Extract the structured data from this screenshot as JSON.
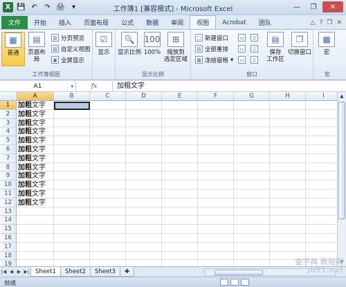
{
  "window": {
    "title": "工作簿1  [兼容模式] - Microsoft Excel",
    "app_icon": "X"
  },
  "tabs": [
    {
      "label": "文件"
    },
    {
      "label": "开始"
    },
    {
      "label": "插入"
    },
    {
      "label": "页面布局"
    },
    {
      "label": "公式"
    },
    {
      "label": "数据"
    },
    {
      "label": "审阅"
    },
    {
      "label": "视图"
    },
    {
      "label": "Acrobat"
    },
    {
      "label": "团队"
    }
  ],
  "ribbon": {
    "workbook_views": {
      "label": "工作簿视图",
      "normal": "普通",
      "page_layout": "页面布局",
      "page_break": "分页预览",
      "custom": "自定义视图",
      "fullscreen": "全屏显示"
    },
    "show": {
      "label": "显示"
    },
    "zoom": {
      "label": "显示比例",
      "zoom": "显示比例",
      "zoom100": "100%",
      "zoom_selection_1": "缩放到",
      "zoom_selection_2": "选定区域"
    },
    "window": {
      "label": "窗口",
      "new_window": "新建窗口",
      "arrange_all": "全部重排",
      "freeze": "冻结窗格",
      "save_workspace_1": "保存",
      "save_workspace_2": "工作区",
      "switch_windows": "切换窗口"
    },
    "macros": {
      "label": "宏",
      "macros": "宏"
    }
  },
  "formula_bar": {
    "name_box": "A1",
    "fx": "fx",
    "content": "加粗文字"
  },
  "grid": {
    "columns": [
      "A",
      "B",
      "C",
      "D",
      "E",
      "F",
      "G",
      "H",
      "I"
    ],
    "rows": [
      "1",
      "2",
      "3",
      "4",
      "5",
      "6",
      "7",
      "8",
      "9",
      "10",
      "11",
      "12",
      "13",
      "14",
      "15",
      "16",
      "17",
      "18",
      "19"
    ],
    "cells": [
      {
        "bold": "加粗",
        "normal": "文字"
      },
      {
        "bold": "加粗",
        "normal": "文字"
      },
      {
        "bold": "加粗",
        "normal": "文字"
      },
      {
        "bold": "加粗",
        "normal": "文字"
      },
      {
        "bold": "加粗",
        "normal": "文字"
      },
      {
        "bold": "加粗",
        "normal": "文字"
      },
      {
        "bold": "加粗",
        "normal": "文字"
      },
      {
        "bold": "加粗",
        "normal": "文字"
      },
      {
        "bold": "加粗",
        "normal": "文字"
      },
      {
        "bold": "加粗",
        "normal": "文字"
      },
      {
        "bold": "加粗",
        "normal": "文字"
      },
      {
        "bold": "加粗",
        "normal": "文字"
      }
    ]
  },
  "sheets": [
    {
      "label": "Sheet1"
    },
    {
      "label": "Sheet2"
    },
    {
      "label": "Sheet3"
    }
  ],
  "status": {
    "mode": "就绪"
  },
  "watermark": {
    "line1": "查字典 教程网",
    "line2": "jb51.net"
  },
  "colors": {
    "file_tab": "#2a8f45",
    "selected_view": "#f8c948",
    "selection_fill": "#b8cce4"
  }
}
